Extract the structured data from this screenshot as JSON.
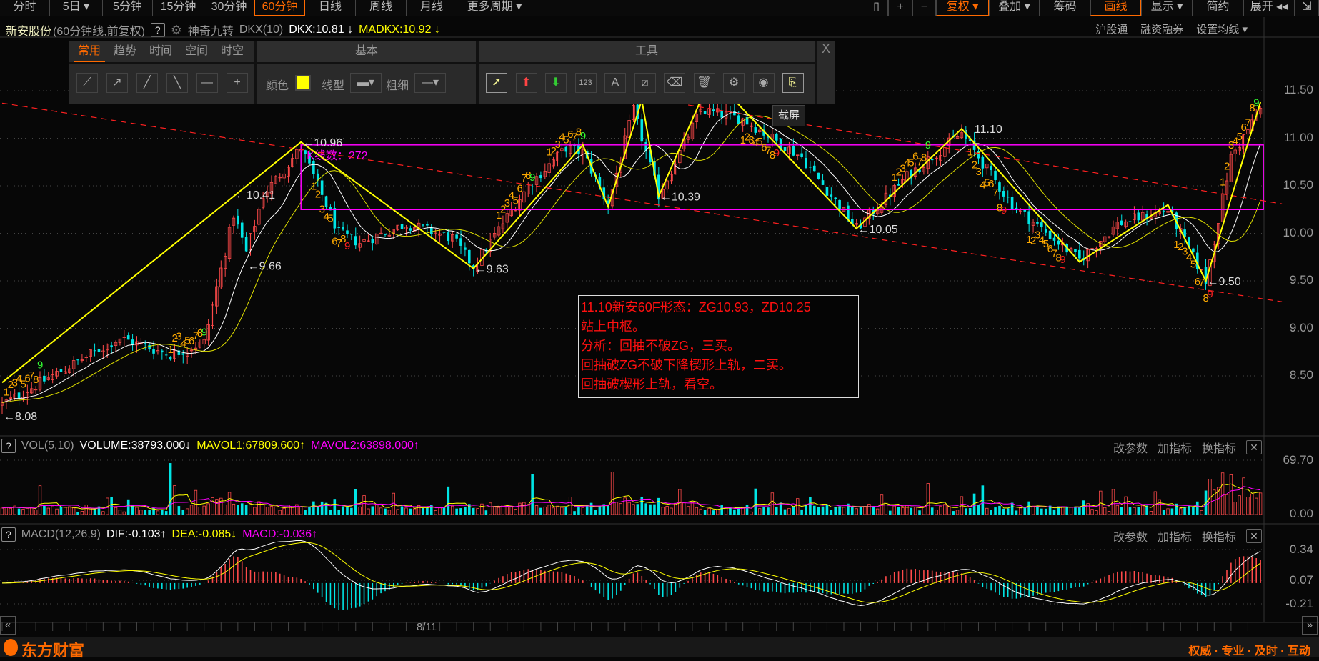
{
  "top_tabs": [
    {
      "label": "分时"
    },
    {
      "label": "5日 ▾"
    },
    {
      "label": "5分钟"
    },
    {
      "label": "15分钟"
    },
    {
      "label": "30分钟"
    },
    {
      "label": "60分钟",
      "active": true
    },
    {
      "label": "日线"
    },
    {
      "label": "周线"
    },
    {
      "label": "月线"
    },
    {
      "label": "更多周期 ▾"
    }
  ],
  "top_right": [
    {
      "label": "▯"
    },
    {
      "label": "+"
    },
    {
      "label": "−"
    },
    {
      "label": "复权 ▾",
      "accent": true
    },
    {
      "label": "叠加 ▾"
    },
    {
      "label": "筹码"
    },
    {
      "label": "画线",
      "accent": true
    },
    {
      "label": "显示 ▾"
    },
    {
      "label": "简约"
    },
    {
      "label": "展开 ◂◂"
    },
    {
      "label": "⇲"
    }
  ],
  "info": {
    "stock": "新安股份",
    "period": "(60分钟线,前复权)",
    "help": "?",
    "indicator": "神奇九转",
    "dkx_param": "DKX(10)",
    "dkx": "DKX:10.81",
    "dkx_arrow": "↓",
    "madkx": "MADKX:10.92",
    "madkx_arrow": "↓"
  },
  "right_links": [
    "沪股通",
    "融资融券",
    "设置均线 ▾"
  ],
  "draw_panel": {
    "tabs": [
      "常用",
      "趋势",
      "时间",
      "空间",
      "时空"
    ],
    "basic_title": "基本",
    "tools_title": "工具",
    "color_label": "颜色",
    "color_value": "#ffff00",
    "linetype_label": "线型",
    "thickness_label": "粗细",
    "line_tools": [
      "line-segment",
      "ray",
      "extended-line",
      "down-line",
      "horizontal-line",
      "cross"
    ],
    "tools": [
      "cursor",
      "up-arrow",
      "down-arrow",
      "price-label-123",
      "text-A",
      "ruler",
      "eraser",
      "delete",
      "settings",
      "hide",
      "screenshot"
    ],
    "tooltip": "截屏",
    "close": "X"
  },
  "price_axis": [
    "11.50",
    "11.00",
    "10.50",
    "10.00",
    "9.50",
    "9.00",
    "8.50"
  ],
  "note": [
    "11.10新安60F形态：ZG10.93，ZD10.25",
    "站上中枢。",
    "分析：回抽不破ZG，三买。",
    "回抽破ZG不破下降楔形上轨，二买。",
    "回抽破楔形上轨，看空。"
  ],
  "chart_data": {
    "type": "candlestick",
    "title": "新安股份 60分钟线 前复权",
    "bar_count_label": "K线数：272",
    "ylim": [
      8.0,
      11.7
    ],
    "zigzag": [
      [
        0,
        8.43
      ],
      [
        71,
        10.96
      ],
      [
        112,
        9.63
      ],
      [
        138,
        10.93
      ],
      [
        144,
        10.28
      ],
      [
        152,
        11.4
      ],
      [
        156,
        10.39
      ],
      [
        166,
        11.4
      ],
      [
        174,
        11.4
      ],
      [
        203,
        10.05
      ],
      [
        228,
        11.1
      ],
      [
        256,
        9.7
      ],
      [
        277,
        10.3
      ],
      [
        286,
        9.5
      ],
      [
        299,
        11.38
      ]
    ],
    "price_path": [
      [
        0,
        8.2
      ],
      [
        10,
        8.45
      ],
      [
        28,
        8.9
      ],
      [
        40,
        8.72
      ],
      [
        48,
        8.85
      ],
      [
        55,
        10.2
      ],
      [
        58,
        9.8
      ],
      [
        62,
        10.4
      ],
      [
        71,
        10.9
      ],
      [
        80,
        10.0
      ],
      [
        85,
        9.9
      ],
      [
        96,
        10.1
      ],
      [
        107,
        9.95
      ],
      [
        112,
        9.65
      ],
      [
        125,
        10.5
      ],
      [
        134,
        10.9
      ],
      [
        138,
        10.85
      ],
      [
        144,
        10.3
      ],
      [
        150,
        11.3
      ],
      [
        156,
        10.4
      ],
      [
        166,
        11.3
      ],
      [
        176,
        11.2
      ],
      [
        190,
        10.8
      ],
      [
        203,
        10.05
      ],
      [
        215,
        10.6
      ],
      [
        228,
        11.05
      ],
      [
        240,
        10.3
      ],
      [
        256,
        9.72
      ],
      [
        265,
        10.1
      ],
      [
        277,
        10.25
      ],
      [
        286,
        9.5
      ],
      [
        292,
        10.8
      ],
      [
        299,
        11.3
      ]
    ],
    "zhongshu": {
      "zg": 10.93,
      "zd": 10.25,
      "from_bar": 71,
      "to_bar": 299
    },
    "trend_lines": [
      {
        "from": [
          0,
          11.37
        ],
        "to": [
          299,
          9.28
        ]
      },
      {
        "from": [
          163,
          11.35
        ],
        "to": [
          299,
          10.31
        ]
      }
    ],
    "price_marks": [
      {
        "bar": 71,
        "price": 10.96,
        "text": "←10.96"
      },
      {
        "bar": 55,
        "price": 10.41,
        "text": "←10.41"
      },
      {
        "bar": 58,
        "price": 9.66,
        "text": "←9.66"
      },
      {
        "bar": 112,
        "price": 9.63,
        "text": "←9.63"
      },
      {
        "bar": 156,
        "price": 10.39,
        "text": "←10.39"
      },
      {
        "bar": 228,
        "price": 11.1,
        "text": "←11.10"
      },
      {
        "bar": 203,
        "price": 10.05,
        "text": "←10.05"
      },
      {
        "bar": 286,
        "price": 9.5,
        "text": "←9.50"
      },
      {
        "bar": 0,
        "price": 8.08,
        "text": "←8.08"
      }
    ],
    "nine_turn": [
      {
        "start": 1,
        "dir": "up"
      },
      {
        "start": 40,
        "dir": "up"
      },
      {
        "start": 74,
        "dir": "down"
      },
      {
        "start": 118,
        "dir": "up"
      },
      {
        "start": 130,
        "dir": "up"
      },
      {
        "start": 176,
        "dir": "down"
      },
      {
        "start": 212,
        "dir": "up"
      },
      {
        "start": 230,
        "dir": "down"
      },
      {
        "start": 244,
        "dir": "down"
      },
      {
        "start": 279,
        "dir": "down"
      },
      {
        "start": 290,
        "dir": "up"
      }
    ],
    "x_tick_label": "8/11"
  },
  "volume": {
    "help": "?",
    "name": "VOL(5,10)",
    "volume": "VOLUME:38793.000",
    "volume_arrow": "↓",
    "mavol1": "MAVOL1:67809.600",
    "mavol1_arrow": "↑",
    "mavol2": "MAVOL2:63898.000",
    "mavol2_arrow": "↑",
    "axis": [
      "69.70",
      "0.00"
    ],
    "ylim": [
      0,
      69.7
    ]
  },
  "macd": {
    "help": "?",
    "name": "MACD(12,26,9)",
    "dif": "DIF:-0.103",
    "dif_arrow": "↑",
    "dea": "DEA:-0.085",
    "dea_arrow": "↓",
    "macd": "MACD:-0.036",
    "macd_arrow": "↑",
    "axis": [
      "0.34",
      "0.07",
      "-0.21"
    ],
    "ylim": [
      -0.21,
      0.34
    ]
  },
  "indicator_buttons": [
    "改参数",
    "加指标",
    "换指标"
  ],
  "footer": {
    "brand": "东方财富",
    "slogan": "权威 · 专业 · 及时 · 互动"
  },
  "colors": {
    "up": "#ff4a4a",
    "down": "#00e5e5",
    "accent": "#ff6a00",
    "zigzag": "#ffff00",
    "zhongshu": "#ff00ff",
    "trend": "#ff2020",
    "note": "#ff1010"
  }
}
